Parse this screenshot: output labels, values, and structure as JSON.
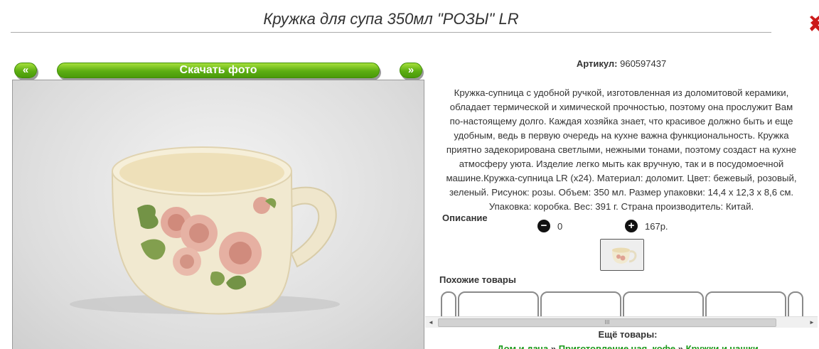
{
  "page": {
    "title": "Кружка для супа 350мл \"РОЗЫ\" LR"
  },
  "gallery": {
    "prev_label": "«",
    "next_label": "»",
    "download_label": "Скачать фото"
  },
  "product": {
    "article_label": "Артикул:",
    "article_value": "960597437",
    "description_lines": [
      "Кружка-супница с удобной ручкой, изготовленная из доломитовой керамики,",
      "обладает термической и химической прочностью, поэтому она прослужит Вам",
      "по-настоящему долго. Каждая хозяйка знает, что красивое должно быть и еще",
      "удобным, ведь в первую очередь на кухне важна функциональность. Кружка",
      "приятно задекорирована светлыми, нежными тонами, поэтому создаст на кухне",
      "атмосферу уюта. Изделие легко мыть как вручную, так и в посудомоечной",
      "машине.Кружка-супница LR (x24). Материал: доломит. Цвет: бежевый, розовый,",
      "зеленый. Рисунок: розы. Объем: 350 мл. Размер упаковки: 14,4 х 12,3 х 8,6 см.",
      "Упаковка: коробка. Вес: 391 г. Страна производитель: Китай."
    ],
    "description_label": "Описание",
    "minus_icon": "−",
    "plus_icon": "+",
    "quantity": "0",
    "price": "167р."
  },
  "similar": {
    "label": "Похожие товары"
  },
  "scrollbar": {
    "left_arrow": "◄",
    "right_arrow": "►",
    "grip": "III"
  },
  "more": {
    "label": "Ещё товары:",
    "crumbs": [
      "Дом и дача",
      "Приготовление чая, кофе",
      "Кружки и чашки"
    ],
    "separator": "»"
  },
  "colors": {
    "accent_green": "#5cae12",
    "link_green": "#1a9a1a",
    "close_red": "#cc1a1a"
  }
}
